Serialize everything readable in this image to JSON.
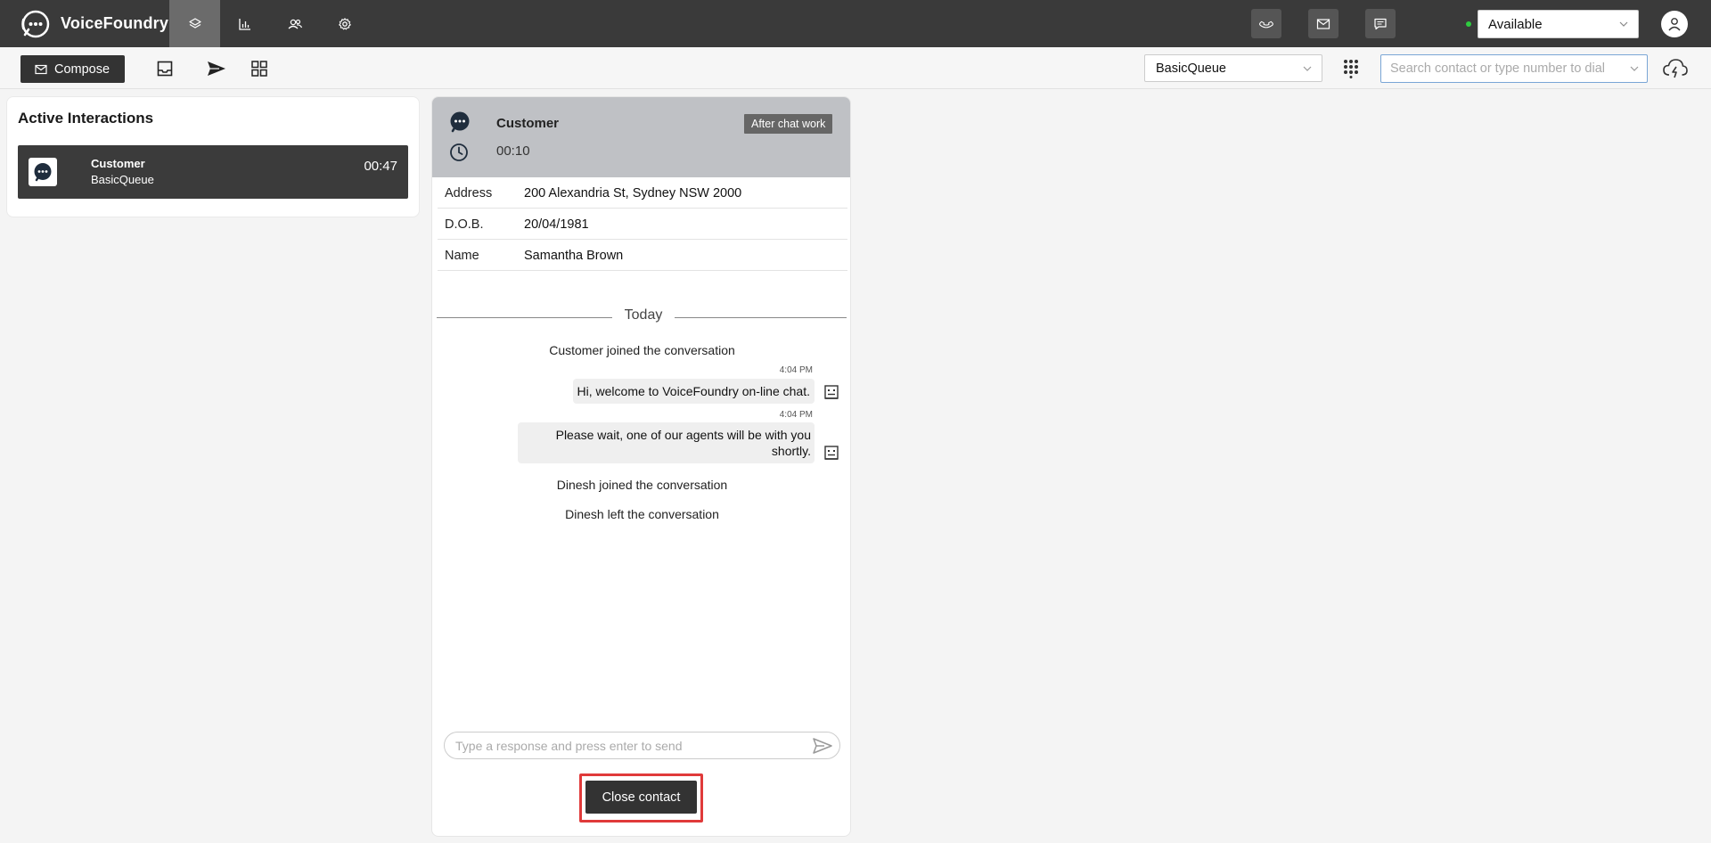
{
  "app": {
    "brand_name": "VoiceFoundry",
    "accent_color": "#3a3a3a"
  },
  "topnav": {
    "tabs": [
      {
        "icon": "layers-icon",
        "active": true
      },
      {
        "icon": "bar-chart-icon",
        "active": false
      },
      {
        "icon": "users-icon",
        "active": false
      },
      {
        "icon": "gear-icon",
        "active": false
      }
    ],
    "channel_buttons": [
      "phone-icon",
      "mail-icon",
      "chat-icon"
    ],
    "status": {
      "value": "Available",
      "dot_color": "#2ecc40"
    }
  },
  "toolbar": {
    "compose_label": "Compose",
    "icons": [
      "inbox-icon",
      "send-icon",
      "grid-icon"
    ],
    "queue": "BasicQueue",
    "search_placeholder": "Search contact or type number to dial"
  },
  "active_interactions": {
    "title": "Active Interactions",
    "items": [
      {
        "name": "Customer",
        "queue": "BasicQueue",
        "time": "00:47"
      }
    ]
  },
  "chat": {
    "header": {
      "name": "Customer",
      "timer": "00:10",
      "badge": "After chat work",
      "bg_color": "#bfc1c5"
    },
    "info": [
      {
        "label": "Address",
        "value": "200 Alexandria St, Sydney NSW 2000"
      },
      {
        "label": "D.O.B.",
        "value": "20/04/1981"
      },
      {
        "label": "Name",
        "value": "Samantha Brown"
      }
    ],
    "divider_label": "Today",
    "messages": {
      "joined_customer": "Customer joined the conversation",
      "msg1_time": "4:04 PM",
      "msg1_text": "Hi, welcome to VoiceFoundry on-line chat.",
      "msg2_time": "4:04 PM",
      "msg2_line1": "Please wait, one of our agents will be with you",
      "msg2_line2": "shortly.",
      "joined_agent": "Dinesh joined the conversation",
      "left_agent": "Dinesh left the conversation"
    },
    "reply_placeholder": "Type a response and press enter to send",
    "close_label": "Close contact",
    "highlight_color": "#e03a3a"
  }
}
